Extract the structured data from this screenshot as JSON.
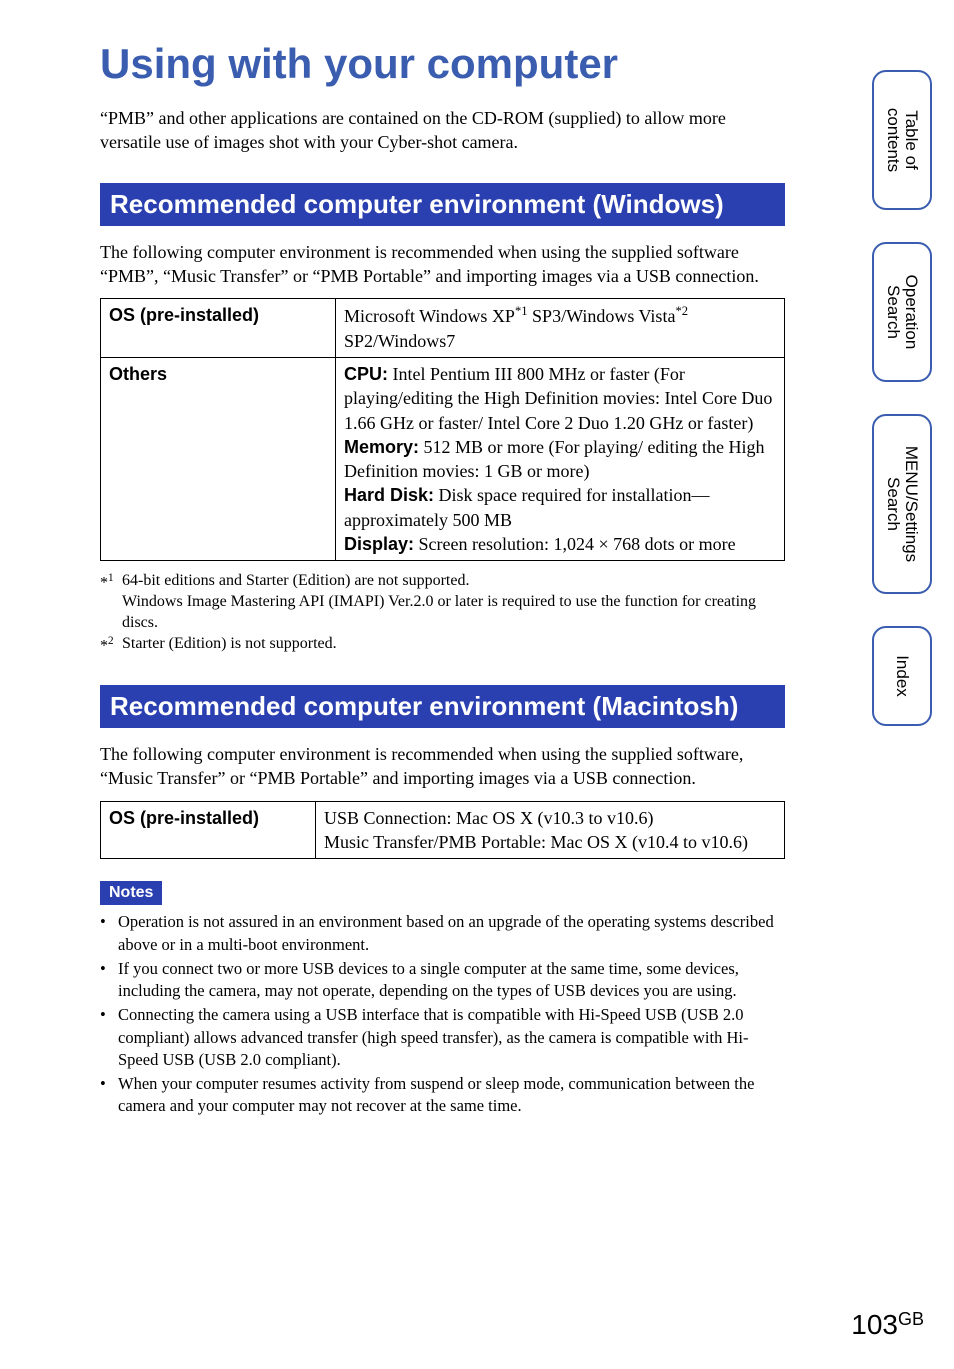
{
  "title": "Using with your computer",
  "intro": "“PMB” and other applications are contained on the CD-ROM (supplied) to allow more versatile use of images shot with your Cyber-shot camera.",
  "side_tabs": [
    {
      "label": "Table of\ncontents"
    },
    {
      "label": "Operation\nSearch"
    },
    {
      "label": "MENU/Settings\nSearch"
    },
    {
      "label": "Index"
    }
  ],
  "windows": {
    "heading": "Recommended computer environment (Windows)",
    "intro": "The following computer environment is recommended when using the supplied software “PMB”, “Music Transfer” or “PMB Portable” and importing images via a USB connection.",
    "rows": [
      {
        "label": "OS (pre-installed)",
        "prefix": "Microsoft Windows XP",
        "sup1": "*1",
        "mid": " SP3/Windows Vista",
        "sup2": "*2",
        "suffix": " SP2/Windows7"
      },
      {
        "label": "Others",
        "lines": {
          "cpu_label": "CPU:",
          "cpu_text": " Intel Pentium III 800 MHz or faster (For playing/editing the High Definition movies: Intel Core Duo 1.66 GHz or faster/ Intel Core 2 Duo 1.20 GHz or faster)",
          "mem_label": "Memory:",
          "mem_text": " 512 MB or more (For playing/ editing the High Definition movies: 1 GB or more)",
          "hd_label": "Hard Disk:",
          "hd_text": " Disk space required for installation—approximately 500 MB",
          "disp_label": "Display:",
          "disp_text": " Screen resolution: 1,024 × 768 dots or more"
        }
      }
    ],
    "footnotes": [
      {
        "mark": "*1",
        "text": "64-bit editions and Starter (Edition) are not supported.\nWindows Image Mastering API (IMAPI) Ver.2.0 or later is required to use the function for creating discs."
      },
      {
        "mark": "*2",
        "text": "Starter (Edition) is not supported."
      }
    ]
  },
  "mac": {
    "heading": "Recommended computer environment (Macintosh)",
    "intro": "The following computer environment is recommended when using the supplied software, “Music Transfer” or “PMB Portable” and importing images via a USB connection.",
    "rows": [
      {
        "label": "OS (pre-installed)",
        "line1": "USB Connection: Mac OS X (v10.3 to v10.6)",
        "line2": "Music Transfer/PMB Portable: Mac OS X (v10.4 to v10.6)"
      }
    ]
  },
  "notes_header": "Notes",
  "notes": [
    "Operation is not assured in an environment based on an upgrade of the operating systems described above or in a multi-boot environment.",
    "If you connect two or more USB devices to a single computer at the same time, some devices, including the camera, may not operate, depending on the types of USB devices you are using.",
    "Connecting the camera using a USB interface that is compatible with Hi-Speed USB (USB 2.0 compliant) allows advanced transfer (high speed transfer), as the camera is compatible with Hi-Speed USB (USB 2.0 compliant).",
    "When your computer resumes activity from suspend or sleep mode, communication between the camera and your computer may not recover at the same time."
  ],
  "page_number": "103",
  "page_suffix": "GB"
}
